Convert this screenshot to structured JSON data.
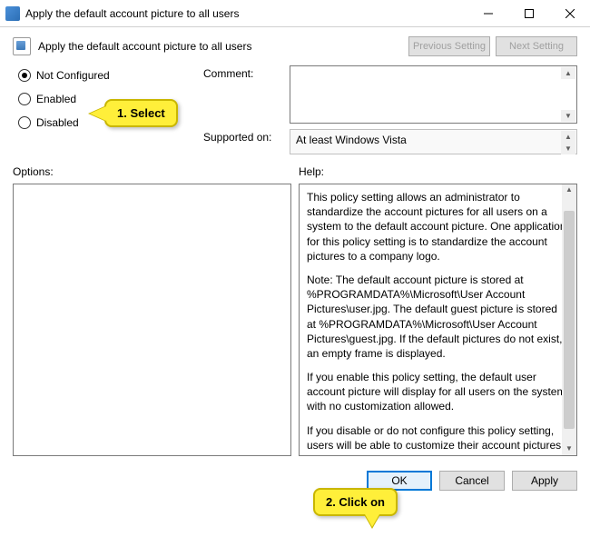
{
  "title": "Apply the default account picture to all users",
  "header": {
    "text": "Apply the default account picture to all users"
  },
  "nav": {
    "prev": "Previous Setting",
    "next": "Next Setting"
  },
  "radios": {
    "not_configured": "Not Configured",
    "enabled": "Enabled",
    "disabled": "Disabled",
    "selected": "not_configured"
  },
  "fields": {
    "comment_label": "Comment:",
    "supported_label": "Supported on:",
    "supported_value": "At least Windows Vista"
  },
  "panels": {
    "options_label": "Options:",
    "help_label": "Help:"
  },
  "help": {
    "p1": "This policy setting allows an administrator to standardize the account pictures for all users on a system to the default account picture. One application for this policy setting is to standardize the account pictures to a company logo.",
    "p2": "Note: The default account picture is stored at %PROGRAMDATA%\\Microsoft\\User Account Pictures\\user.jpg. The default guest picture is stored at %PROGRAMDATA%\\Microsoft\\User Account Pictures\\guest.jpg. If the default pictures do not exist, an empty frame is displayed.",
    "p3": "If you enable this policy setting, the default user account picture will display for all users on the system with no customization allowed.",
    "p4": "If you disable or do not configure this policy setting, users will be able to customize their account pictures."
  },
  "footer": {
    "ok": "OK",
    "cancel": "Cancel",
    "apply": "Apply"
  },
  "callouts": {
    "one": "1. Select",
    "two": "2. Click on"
  }
}
